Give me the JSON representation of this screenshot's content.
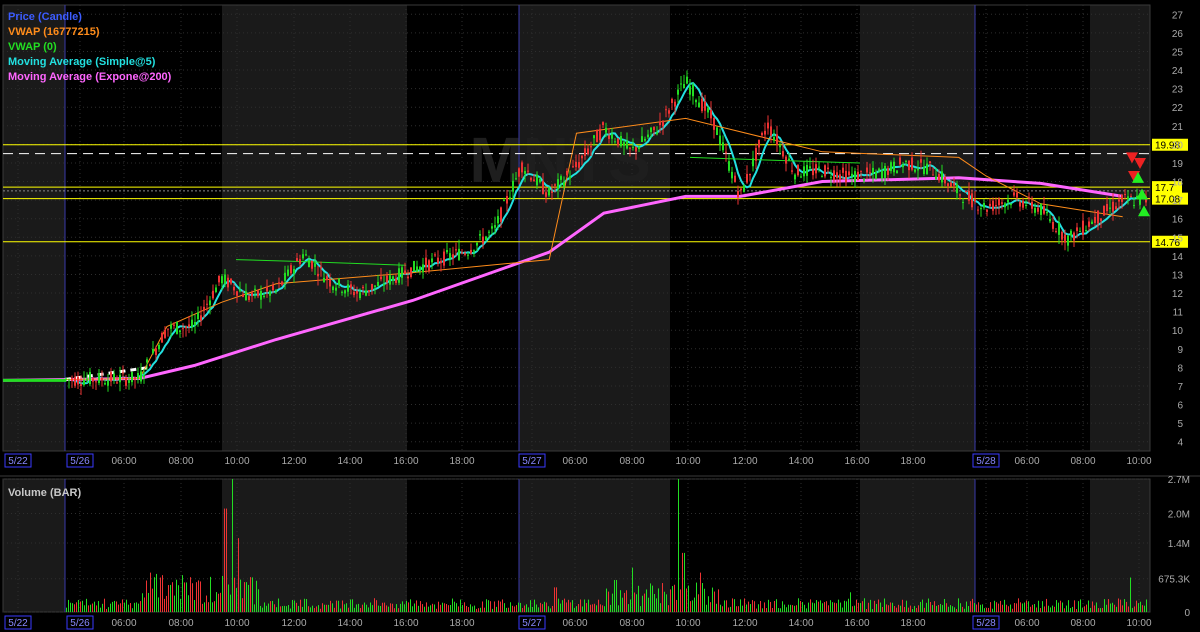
{
  "legend": {
    "price": {
      "label": "Price (Candle)",
      "color": "#3c5cff"
    },
    "vwap1": {
      "label": "VWAP (16777215)",
      "color": "#ff8c1a"
    },
    "vwap2": {
      "label": "VWAP (0)",
      "color": "#22dd22"
    },
    "sma": {
      "label": "Moving Average (Simple@5)",
      "color": "#22e0e0"
    },
    "ema": {
      "label": "Moving Average (Expone@200)",
      "color": "#ff66ff"
    }
  },
  "watermark": "MNTS",
  "volume_panel": {
    "title": "Volume (BAR)"
  },
  "colors": {
    "up": "#22dd22",
    "down": "#ee3333",
    "grid": "#2e2e2e",
    "level": "#ffff00",
    "panel_bg": "#000000",
    "alt_bg": "#1a1a1a"
  },
  "x_ticks": [
    "5/22",
    "5/26",
    "06:00",
    "08:00",
    "10:00",
    "12:00",
    "14:00",
    "16:00",
    "18:00",
    "5/27",
    "06:00",
    "08:00",
    "10:00",
    "12:00",
    "14:00",
    "16:00",
    "18:00",
    "5/28",
    "06:00",
    "08:00",
    "10:00"
  ],
  "boxed_ticks": [
    "5/22",
    "5/26",
    "5/27",
    "5/28"
  ],
  "chart_data": [
    {
      "type": "line",
      "subtype": "candlestick",
      "title": "",
      "ylim": [
        3.5,
        27.5
      ],
      "yticks": [
        4,
        5,
        6,
        7,
        8,
        9,
        10,
        11,
        12,
        13,
        14,
        15,
        16,
        17,
        18,
        19,
        20,
        21,
        22,
        23,
        24,
        25,
        26,
        27
      ],
      "price_levels": [
        {
          "value": 19.98,
          "label": "19.98"
        },
        {
          "value": 17.7,
          "label": "17.7"
        },
        {
          "value": 17.08,
          "label": "17.08"
        },
        {
          "value": 14.76,
          "label": "14.76"
        }
      ],
      "series": [
        {
          "name": "Price (Candle)",
          "x": [
            0,
            5,
            6,
            7,
            8,
            9,
            10,
            11,
            12,
            13,
            14,
            15,
            16,
            17,
            18,
            19,
            20,
            21,
            22,
            23,
            24,
            25,
            26,
            27,
            28,
            29,
            30,
            31,
            32,
            33,
            34,
            35,
            36,
            37,
            38,
            39,
            40,
            41
          ],
          "values": [
            7.3,
            7.4,
            10.1,
            10.2,
            12.8,
            11.8,
            12.1,
            14.1,
            12.6,
            12.0,
            12.6,
            13.3,
            13.8,
            14.3,
            15.4,
            18.9,
            17.3,
            18.8,
            20.9,
            19.6,
            20.9,
            23.4,
            21.3,
            17.2,
            21.1,
            18.5,
            18.6,
            18.3,
            18.4,
            19.0,
            18.7,
            17.4,
            16.6,
            17.1,
            16.5,
            14.9,
            16.0,
            17.0
          ]
        },
        {
          "name": "Moving Average (Expone@200)",
          "x": [
            0,
            5,
            7,
            10,
            15,
            20,
            22,
            25,
            27,
            30,
            35,
            38,
            41
          ],
          "values": [
            7.3,
            7.4,
            8.1,
            9.5,
            11.6,
            14.2,
            16.3,
            17.2,
            17.2,
            18.0,
            18.2,
            17.9,
            17.2
          ]
        },
        {
          "name": "VWAP (16777215)",
          "x": [
            0,
            5,
            6,
            8,
            10,
            15,
            20,
            21,
            25,
            30,
            35,
            36,
            38,
            41
          ],
          "values": [
            7.3,
            7.4,
            10.2,
            11.5,
            12.5,
            13.1,
            13.8,
            20.6,
            21.4,
            19.6,
            19.3,
            18.3,
            16.8,
            16.1
          ]
        }
      ]
    },
    {
      "type": "bar",
      "title": "Volume (BAR)",
      "ylim": [
        0,
        2700000
      ],
      "yticks": [
        0,
        675300,
        1400000,
        2000000,
        2700000
      ],
      "ytick_labels": [
        "0",
        "675.3K",
        "1.4M",
        "2.0M",
        "2.7M"
      ]
    }
  ]
}
